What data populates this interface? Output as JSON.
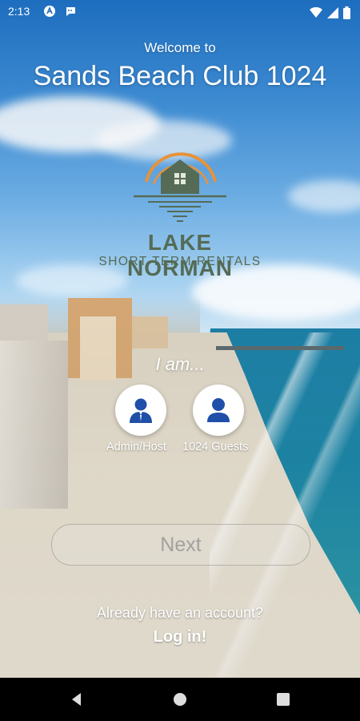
{
  "status_bar": {
    "time": "2:13",
    "icons_left": [
      "accessibility-icon",
      "chat-notification-icon"
    ],
    "icons_right": [
      "wifi-icon",
      "signal-icon",
      "battery-icon"
    ]
  },
  "header": {
    "welcome": "Welcome to",
    "property_title": "Sands Beach Club 1024"
  },
  "logo": {
    "name": "LAKE NORMAN",
    "tagline": "SHORT TERM RENTALS",
    "colors": {
      "green": "#556b55",
      "orange": "#e8923a"
    }
  },
  "role_picker": {
    "prompt": "I am...",
    "options": [
      {
        "label": "Admin/Host",
        "icon": "admin-user-icon"
      },
      {
        "label": "1024 Guests",
        "icon": "guest-user-icon"
      }
    ],
    "icon_color": "#1f4fa8"
  },
  "next_button": {
    "label": "Next",
    "enabled": false
  },
  "footer": {
    "already": "Already have an account?",
    "login": "Log in!"
  },
  "nav_bar": {
    "buttons": [
      "back-icon",
      "home-icon",
      "recents-icon"
    ]
  }
}
